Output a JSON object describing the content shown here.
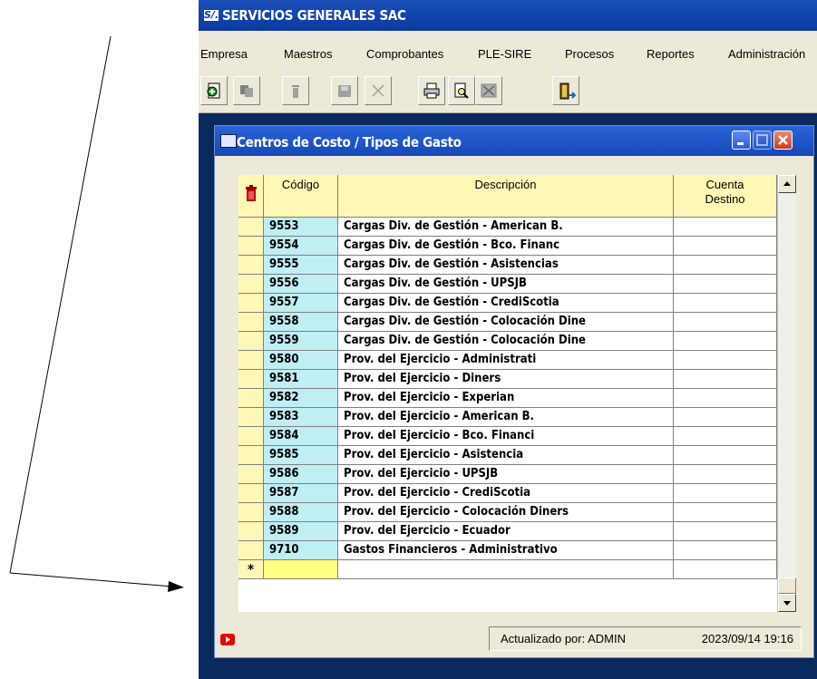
{
  "app": {
    "title": "SERVICIOS GENERALES SAC",
    "icon_text": "S/."
  },
  "menu": [
    "Empresa",
    "Maestros",
    "Comprobantes",
    "PLE-SIRE",
    "Procesos",
    "Reportes",
    "Administración"
  ],
  "toolbar": [
    "new-record-icon",
    "copy-icon",
    "delete-icon",
    "save-icon",
    "cancel-icon",
    "print-icon",
    "preview-icon",
    "export-icon",
    "exit-door-icon"
  ],
  "window": {
    "title": "Centros de Costo / Tipos de Gasto"
  },
  "grid": {
    "columns": {
      "code": "Código",
      "description": "Descripción",
      "account_line1": "Cuenta",
      "account_line2": "Destino"
    },
    "new_row_marker": "*",
    "rows": [
      {
        "code": "9553",
        "description": "Cargas Div. de Gestión - American B.",
        "account": ""
      },
      {
        "code": "9554",
        "description": "Cargas Div. de Gestión - Bco. Financ",
        "account": ""
      },
      {
        "code": "9555",
        "description": "Cargas Div. de Gestión - Asistencias",
        "account": ""
      },
      {
        "code": "9556",
        "description": "Cargas Div. de Gestión - UPSJB",
        "account": ""
      },
      {
        "code": "9557",
        "description": "Cargas Div. de Gestión - CrediScotia",
        "account": ""
      },
      {
        "code": "9558",
        "description": "Cargas Div. de Gestión - Colocación Dine",
        "account": ""
      },
      {
        "code": "9559",
        "description": "Cargas Div. de Gestión - Colocación Dine",
        "account": ""
      },
      {
        "code": "9580",
        "description": "Prov. del Ejercicio - Administrati",
        "account": ""
      },
      {
        "code": "9581",
        "description": "Prov. del Ejercicio - Diners",
        "account": ""
      },
      {
        "code": "9582",
        "description": "Prov. del Ejercicio - Experian",
        "account": ""
      },
      {
        "code": "9583",
        "description": "Prov. del Ejercicio - American B.",
        "account": ""
      },
      {
        "code": "9584",
        "description": "Prov. del Ejercicio - Bco. Financi",
        "account": ""
      },
      {
        "code": "9585",
        "description": "Prov. del Ejercicio - Asistencia",
        "account": ""
      },
      {
        "code": "9586",
        "description": "Prov. del Ejercicio - UPSJB",
        "account": ""
      },
      {
        "code": "9587",
        "description": "Prov. del Ejercicio - CrediScotia",
        "account": ""
      },
      {
        "code": "9588",
        "description": "Prov. del Ejercicio - Colocación Diners",
        "account": ""
      },
      {
        "code": "9589",
        "description": "Prov. del Ejercicio - Ecuador",
        "account": ""
      },
      {
        "code": "9710",
        "description": "Gastos Financieros - Administrativo",
        "account": ""
      }
    ]
  },
  "status": {
    "updated_by": "Actualizado por: ADMIN",
    "timestamp": "2023/09/14 19:16"
  },
  "colors": {
    "code_column": "#bfeef5",
    "header": "#fff7b5",
    "selector_column": "#fff7b5",
    "new_row": "#ffff80",
    "title_bar": "#0b3aa0",
    "desktop": "#0a2a5e",
    "close_button": "#d8471f"
  }
}
